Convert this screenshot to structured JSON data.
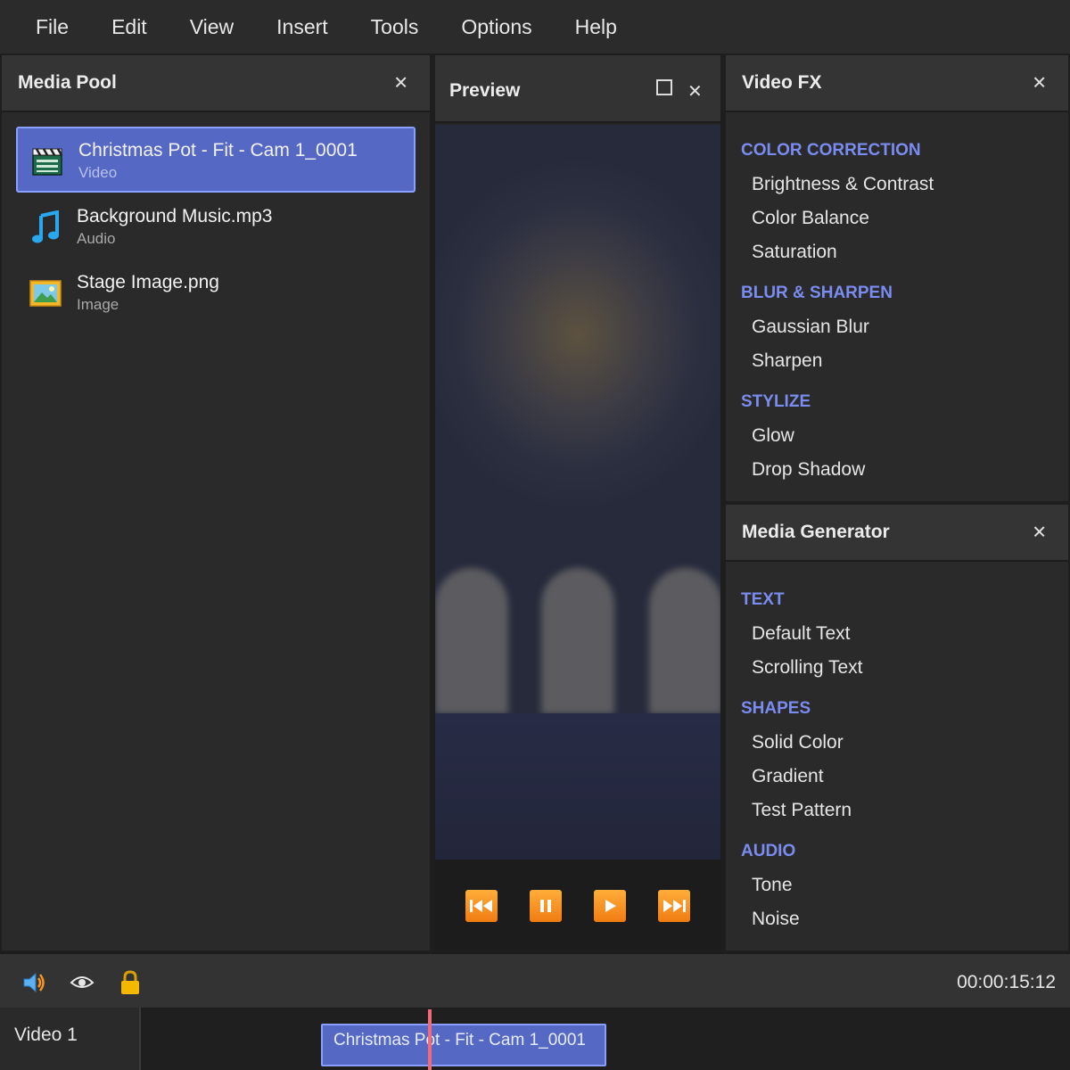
{
  "menu": [
    "File",
    "Edit",
    "View",
    "Insert",
    "Tools",
    "Options",
    "Help"
  ],
  "media_pool": {
    "title": "Media Pool",
    "items": [
      {
        "name": "Christmas Pot - Fit - Cam 1_0001",
        "type": "Video",
        "icon": "clapperboard-icon",
        "selected": true
      },
      {
        "name": "Background Music.mp3",
        "type": "Audio",
        "icon": "music-note-icon",
        "selected": false
      },
      {
        "name": "Stage Image.png",
        "type": "Image",
        "icon": "picture-icon",
        "selected": false
      }
    ]
  },
  "preview": {
    "title": "Preview",
    "controls": [
      "skip-back-icon",
      "pause-icon",
      "play-icon",
      "skip-forward-icon"
    ]
  },
  "video_fx": {
    "title": "Video FX",
    "categories": [
      {
        "name": "COLOR CORRECTION",
        "items": [
          "Brightness & Contrast",
          "Color Balance",
          "Saturation"
        ]
      },
      {
        "name": "BLUR & SHARPEN",
        "items": [
          "Gaussian Blur",
          "Sharpen"
        ]
      },
      {
        "name": "STYLIZE",
        "items": [
          "Glow",
          "Drop Shadow"
        ]
      }
    ]
  },
  "media_generator": {
    "title": "Media Generator",
    "categories": [
      {
        "name": "TEXT",
        "items": [
          "Default Text",
          "Scrolling Text"
        ]
      },
      {
        "name": "SHAPES",
        "items": [
          "Solid Color",
          "Gradient",
          "Test Pattern"
        ]
      },
      {
        "name": "AUDIO",
        "items": [
          "Tone",
          "Noise"
        ]
      }
    ]
  },
  "statusbar": {
    "icons": [
      "speaker-icon",
      "eye-icon",
      "lock-icon"
    ],
    "timecode": "00:00:15:12"
  },
  "timeline": {
    "tracks": [
      {
        "label": "Video 1",
        "clips": [
          {
            "label": "Christmas Pot - Fit - Cam 1_0001"
          }
        ]
      }
    ]
  },
  "colors": {
    "accent": "#5468c4",
    "category": "#7b8cf0",
    "transport": "#f7931e",
    "playhead": "#f06a7a"
  }
}
